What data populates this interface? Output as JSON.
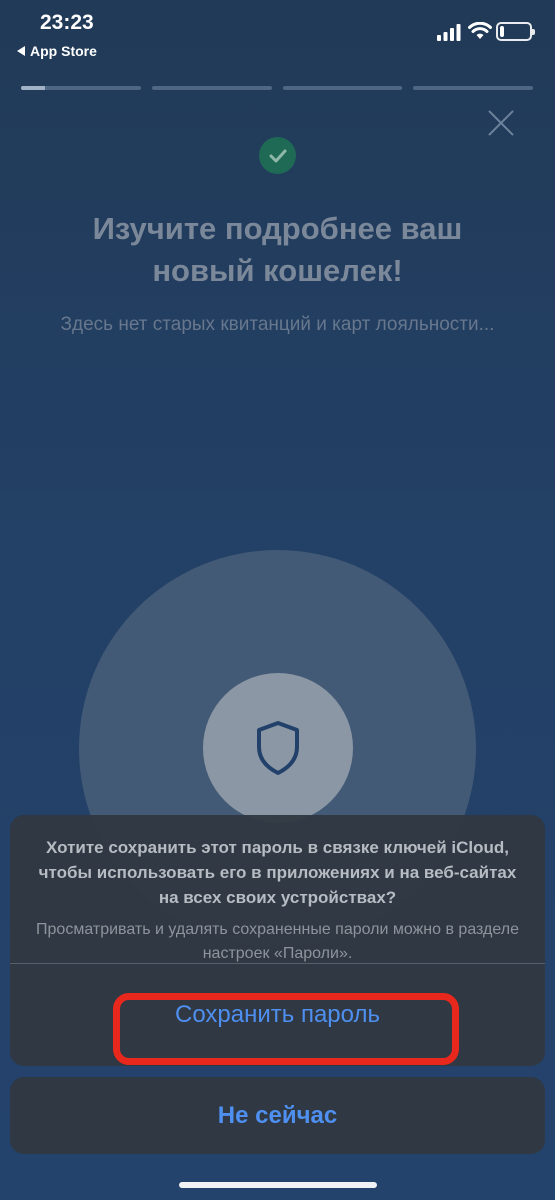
{
  "status_bar": {
    "time": "23:23",
    "back_label": "App Store",
    "battery_level": 0.25,
    "icons": [
      "cellular-signal-icon",
      "wifi-icon",
      "battery-icon"
    ]
  },
  "onboarding": {
    "progress_segments": [
      0.2,
      0,
      0,
      0
    ],
    "check_icon": "checkmark-icon",
    "close_icon": "close-icon",
    "title": "Изучите подробнее ваш новый кошелек!",
    "subtitle": "Здесь нет старых квитанций и карт лояльности...",
    "illustration_icon": "shield-icon"
  },
  "password_sheet": {
    "message": "Хотите сохранить этот пароль в связке ключей iCloud, чтобы использовать его в приложениях и на веб-сайтах на всех своих устройствах?",
    "note": "Просматривать и удалять сохраненные пароли можно в разделе настроек «Пароли».",
    "save_label": "Сохранить пароль",
    "cancel_label": "Не сейчас"
  },
  "colors": {
    "accent": "#4e8ff0",
    "highlight": "#e8281d",
    "check_badge": "#1f6a55",
    "background": "#234066"
  }
}
